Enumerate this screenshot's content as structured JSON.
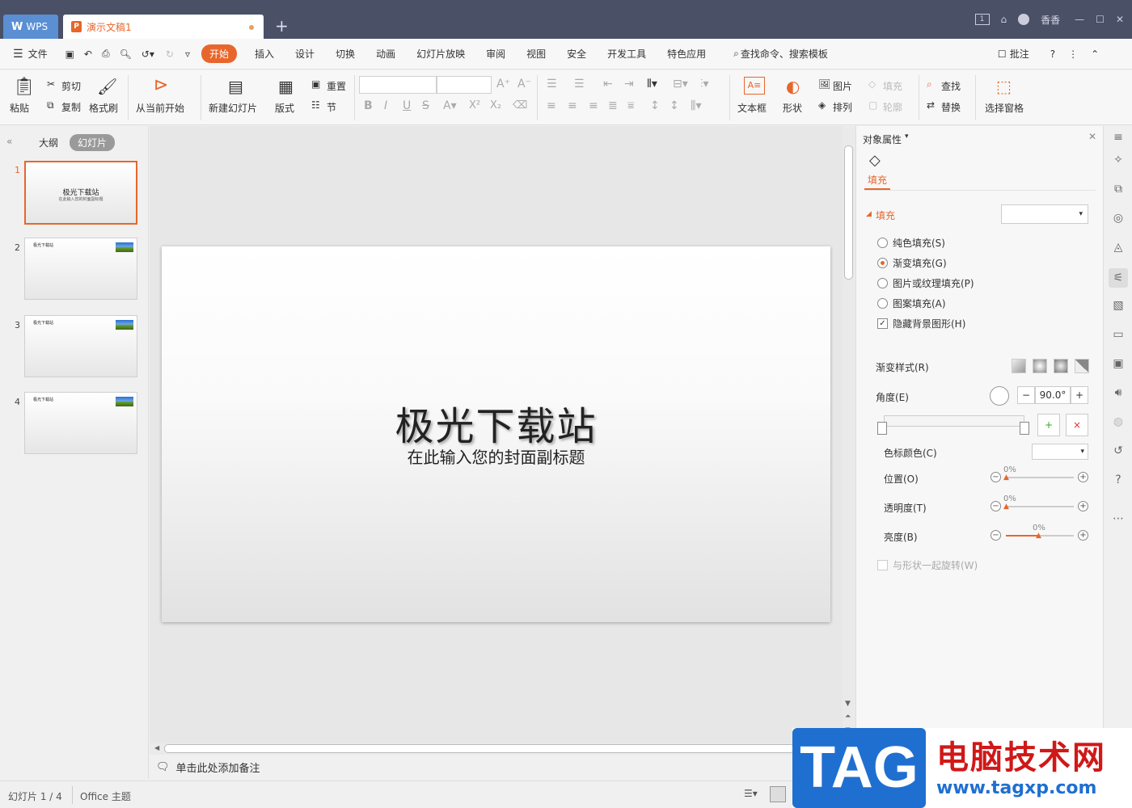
{
  "titlebar": {
    "wps_label": "WPS",
    "doc_tab": "演示文稿1",
    "user": "香香"
  },
  "menu": {
    "file": "文件",
    "items": [
      "开始",
      "插入",
      "设计",
      "切换",
      "动画",
      "幻灯片放映",
      "审阅",
      "视图",
      "安全",
      "开发工具",
      "特色应用"
    ],
    "search": "查找命令、搜索模板",
    "comment": "批注"
  },
  "ribbon": {
    "paste": "粘贴",
    "cut": "剪切",
    "copy": "复制",
    "format_painter": "格式刷",
    "from_current": "从当前开始",
    "new_slide": "新建幻灯片",
    "layout": "版式",
    "reset": "重置",
    "section": "节",
    "textbox": "文本框",
    "shape": "形状",
    "picture": "图片",
    "arrange": "排列",
    "fill": "填充",
    "outline": "轮廓",
    "find": "查找",
    "replace": "替换",
    "select_pane": "选择窗格"
  },
  "leftpane": {
    "outline_tab": "大纲",
    "slides_tab": "幻灯片",
    "slides": [
      {
        "num": "1",
        "title": "极光下载站",
        "sub": "在此输入您的封面副标题"
      },
      {
        "num": "2",
        "title": "极光下载站"
      },
      {
        "num": "3",
        "title": "极光下载站"
      },
      {
        "num": "4",
        "title": "极光下载站"
      }
    ]
  },
  "slide": {
    "title": "极光下载站",
    "subtitle": "在此输入您的封面副标题"
  },
  "notes": {
    "placeholder": "单击此处添加备注"
  },
  "status": {
    "slide_count": "幻灯片 1 / 4",
    "theme": "Office 主题"
  },
  "panel": {
    "header": "对象属性",
    "tab": "填充",
    "section": "填充",
    "options": [
      "纯色填充(S)",
      "渐变填充(G)",
      "图片或纹理填充(P)",
      "图案填充(A)"
    ],
    "hide_bg": "隐藏背景图形(H)",
    "gradient_style": "渐变样式(R)",
    "angle_label": "角度(E)",
    "angle_value": "90.0°",
    "stop_color": "色标颜色(C)",
    "position": "位置(O)",
    "transparency": "透明度(T)",
    "brightness": "亮度(B)",
    "pos_val": "0%",
    "trans_val": "0%",
    "bright_val": "0%",
    "rotate": "与形状一起旋转(W)"
  },
  "watermark": {
    "tag": "TAG",
    "cn": "电脑技术网",
    "url": "www.tagxp.com"
  },
  "colors": {
    "accent": "#e8662b",
    "titlebar": "#4a5066",
    "wm_blue": "#1f6fd0",
    "wm_red": "#d01818"
  }
}
